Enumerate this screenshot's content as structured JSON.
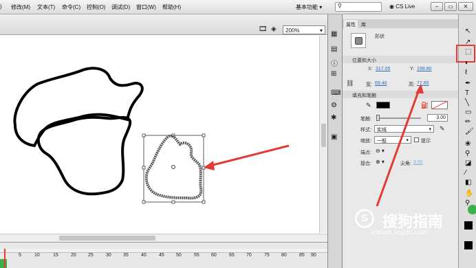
{
  "menu": {
    "items": [
      "文本(T)",
      "修改(M)",
      "文本(T)",
      "命令(C)",
      "控制(O)",
      "调试(D)",
      "窗口(W)",
      "帮助(H)"
    ],
    "first_partial": ")",
    "workspace": "基本功能",
    "cslive": "CS Live"
  },
  "toolbar": {
    "zoom": "200%"
  },
  "panel": {
    "tab_props": "属性",
    "tab_lib": "库",
    "shape_label": "形状",
    "section_pos": "位置和大小",
    "x_label": "X:",
    "x_value": "317.05",
    "y_label": "Y:",
    "y_value": "199.80",
    "w_label": "宽:",
    "w_value": "69.40",
    "h_label": "高:",
    "h_value": "77.65",
    "section_fill": "填充和笔触",
    "stroke_label": "笔触:",
    "stroke_value": "3.00",
    "style_label": "样式:",
    "style_value": "实线",
    "scale_label": "缩放:",
    "scale_value": "一般",
    "hint_label": "提示",
    "cap_label": "端点:",
    "join_label": "接合:",
    "miter_label": "尖角:",
    "miter_value": "3.00"
  },
  "ruler": [
    "1",
    "5",
    "10",
    "15",
    "20",
    "25",
    "30",
    "35",
    "40",
    "45",
    "50",
    "55",
    "60",
    "65",
    "70",
    "75",
    "80",
    "85",
    "90"
  ],
  "watermark": {
    "text": "搜狗指南",
    "sub": "zhinan.sogou.com"
  },
  "colors": {
    "arrow": "#e53935",
    "highlight": "#e53935",
    "stroke_swatch": "#000000"
  }
}
